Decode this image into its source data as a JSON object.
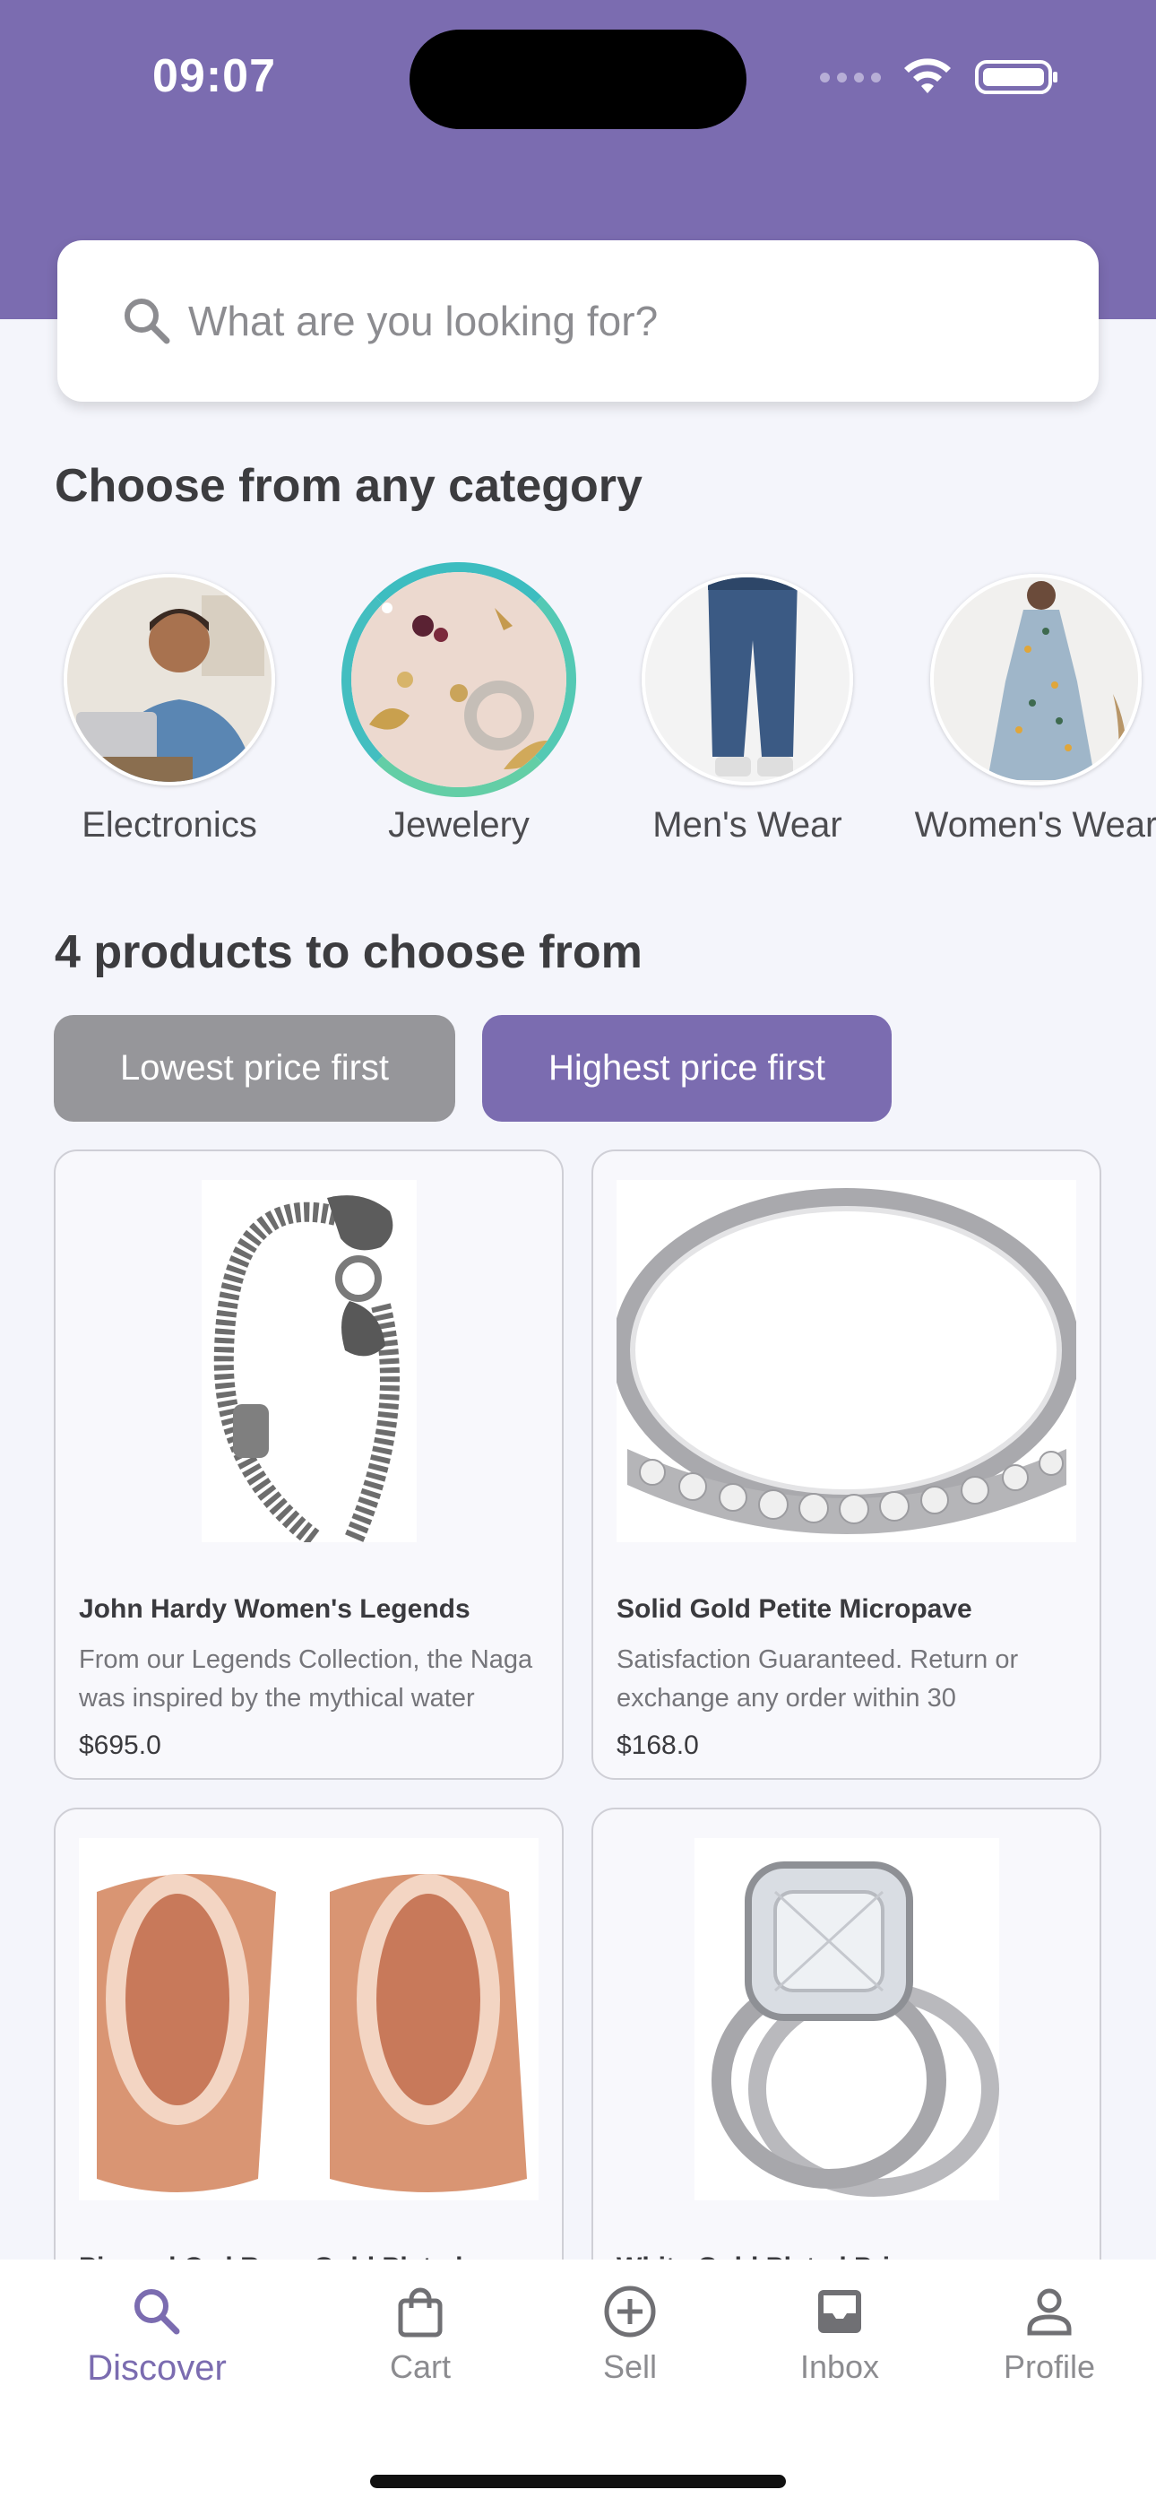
{
  "status_bar": {
    "time": "09:07"
  },
  "search": {
    "placeholder": "What are you looking for?"
  },
  "categories": {
    "heading": "Choose from any category",
    "items": [
      {
        "label": "Electronics",
        "selected": false
      },
      {
        "label": "Jewelery",
        "selected": true
      },
      {
        "label": "Men's Wear",
        "selected": false
      },
      {
        "label": "Women's Wear",
        "selected": false
      }
    ]
  },
  "products": {
    "heading": "4 products to choose from",
    "sort": {
      "lowest_label": "Lowest price first",
      "highest_label": "Highest price first",
      "active": "highest"
    },
    "items": [
      {
        "title": "John Hardy Women's Legends",
        "description": "From our Legends Collection, the Naga was inspired by the mythical water",
        "price": "$695.0"
      },
      {
        "title": "Solid Gold Petite Micropave",
        "description": "Satisfaction Guaranteed. Return or exchange any order within 30",
        "price": "$168.0"
      },
      {
        "title": "Pierced Owl Rose Gold Plated",
        "description": "",
        "price": ""
      },
      {
        "title": "White Gold Plated Princess",
        "description": "",
        "price": ""
      }
    ]
  },
  "tabbar": {
    "items": [
      {
        "label": "Discover",
        "icon": "search-icon",
        "active": true
      },
      {
        "label": "Cart",
        "icon": "bag-icon",
        "active": false
      },
      {
        "label": "Sell",
        "icon": "plus-circle-icon",
        "active": false
      },
      {
        "label": "Inbox",
        "icon": "inbox-icon",
        "active": false
      },
      {
        "label": "Profile",
        "icon": "person-icon",
        "active": false
      }
    ]
  },
  "colors": {
    "accent": "#7b6cb0",
    "inactive_button": "#96969a",
    "selected_ring": "#44c1bd",
    "background": "#f4f5fb"
  }
}
